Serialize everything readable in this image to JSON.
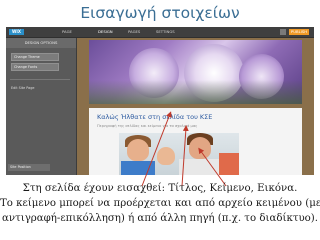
{
  "slide": {
    "title": "Εισαγωγή στοιχείων",
    "caption_lines": [
      "Στη σελίδα έχουν εισαχθεί: Τίτλος, Κείμενο, Εικόνα.",
      "Το κείμενο μπορεί να προέρχεται και από αρχείο κειμένου (με",
      "αντιγραφή-επικόλληση) ή από άλλη πηγή (π.χ. το διαδίκτυο)."
    ]
  },
  "editor": {
    "logo": "WIX",
    "nav": [
      "PAGE",
      "DESIGN",
      "PAGES",
      "SETTINGS"
    ],
    "publish_label": "PUBLISH",
    "panel_header": "DESIGN OPTIONS",
    "panel_options": [
      "Change Theme",
      "Change Fonts"
    ],
    "panel_editor_label": "Edit Site Page",
    "zoom_label": "Site Position"
  },
  "site": {
    "heading": "Καλώς Ήλθατε στη σελίδα του ΚΣΕ",
    "subtext": "Περιγραφή της σελίδας και κείμενο για τα σχολικά μας"
  },
  "colors": {
    "title": "#3a6e94",
    "heading": "#2c5aa0",
    "publish": "#f09a28",
    "arrow": "#c0392b"
  }
}
